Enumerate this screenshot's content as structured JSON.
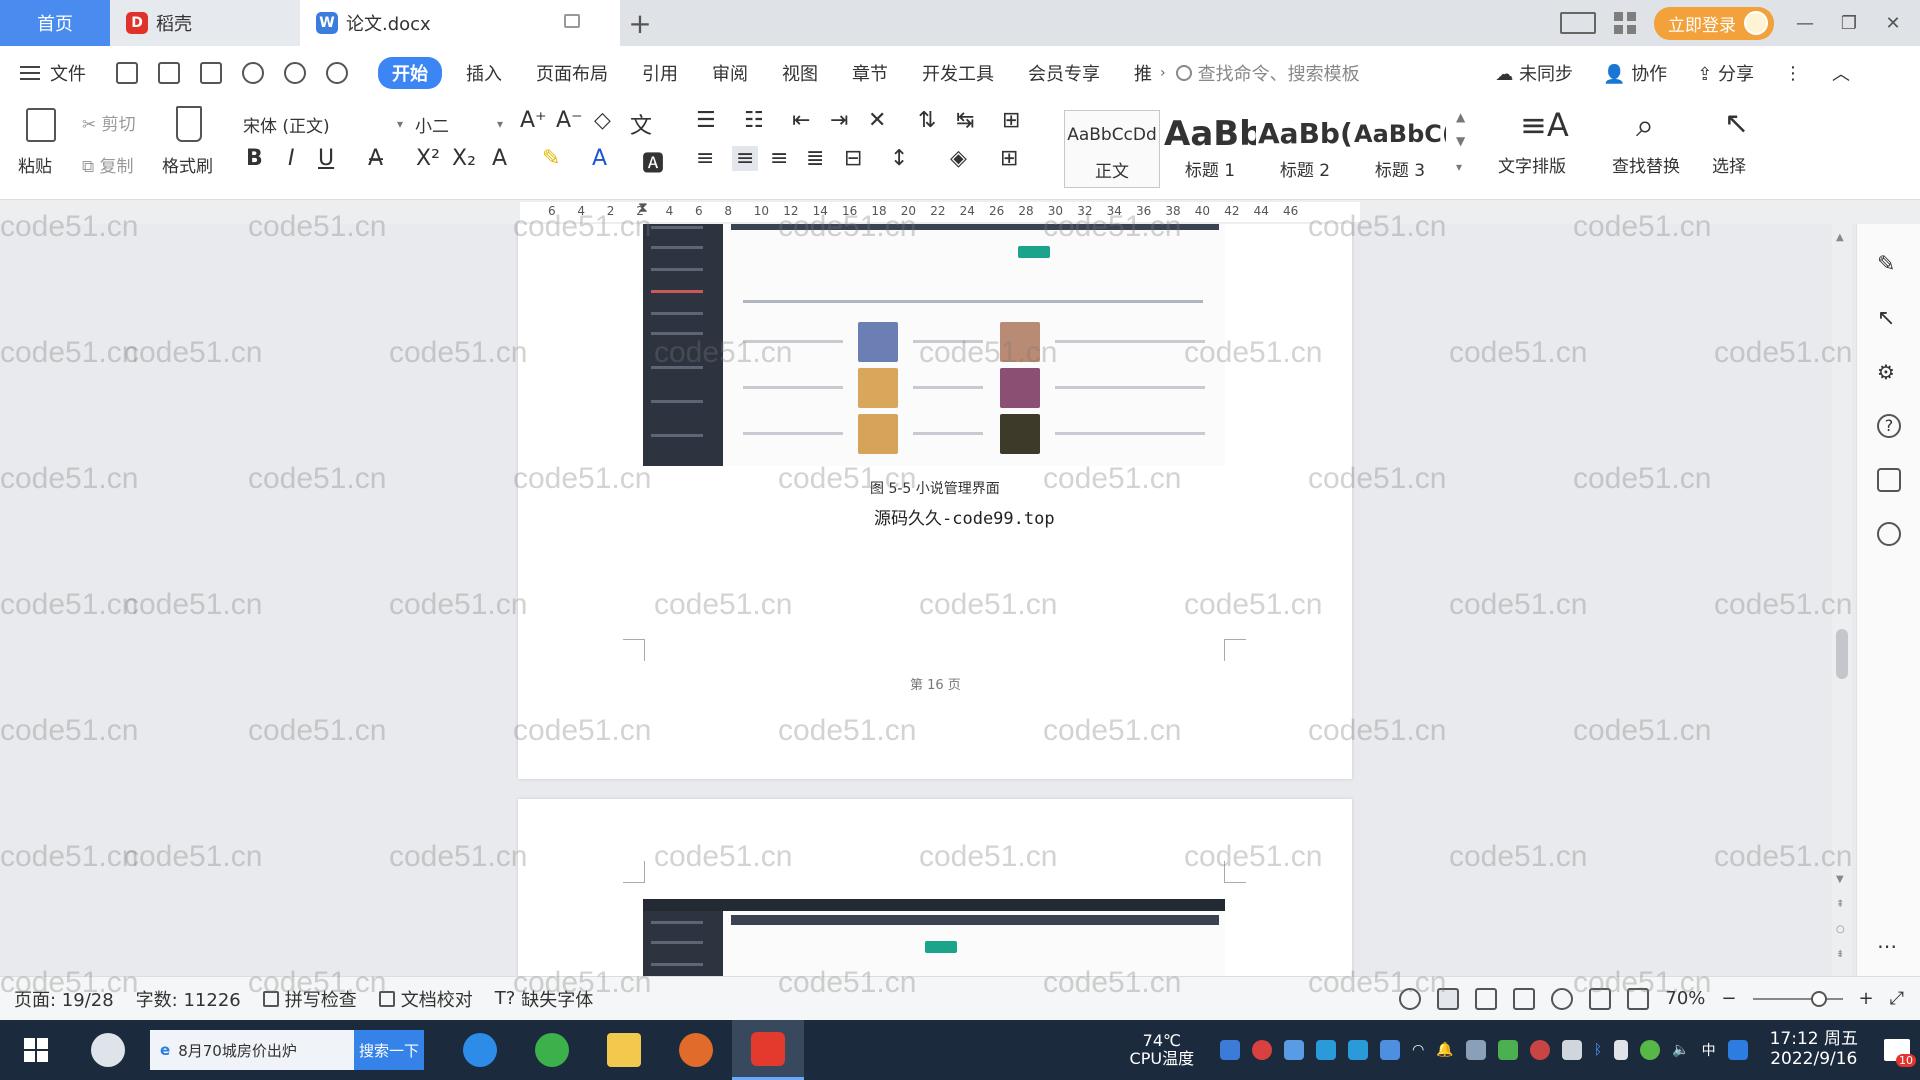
{
  "tabs": {
    "home": "首页",
    "daoke": "稻壳",
    "doc": "论文.docx",
    "new_tab": "+"
  },
  "titlebar": {
    "login": "立即登录"
  },
  "menu": {
    "file": "文件",
    "items": [
      "开始",
      "插入",
      "页面布局",
      "引用",
      "审阅",
      "视图",
      "章节",
      "开发工具",
      "会员专享",
      "推"
    ],
    "active_index": 0,
    "search_cmd": "查找命令、搜索模板",
    "unsynced": "未同步",
    "collab": "协作",
    "share": "分享"
  },
  "ribbon": {
    "paste": "粘贴",
    "cut": "剪切",
    "copy": "复制",
    "format_painter": "格式刷",
    "font_name": "宋体 (正文)",
    "font_size": "小二",
    "styles": [
      {
        "sample": "AaBbCcDd",
        "caption": "正文"
      },
      {
        "sample": "AaBb",
        "caption": "标题 1"
      },
      {
        "sample": "AaBb(",
        "caption": "标题 2"
      },
      {
        "sample": "AaBbC(",
        "caption": "标题 3"
      }
    ],
    "text_layout": "文字排版",
    "find_replace": "查找替换",
    "select": "选择"
  },
  "ruler": {
    "ticks": [
      "6",
      "4",
      "2",
      "2",
      "4",
      "6",
      "8",
      "10",
      "12",
      "14",
      "16",
      "18",
      "20",
      "22",
      "24",
      "26",
      "28",
      "30",
      "32",
      "34",
      "36",
      "38",
      "40",
      "42",
      "44",
      "46"
    ]
  },
  "document": {
    "figure_caption": "图 5-5 小说管理界面",
    "source_line": "源码久久-code99.top",
    "page_label": "第 16 页"
  },
  "status": {
    "page": "页面: 19/28",
    "words": "字数: 11226",
    "spellcheck": "拼写检查",
    "proofread": "文档校对",
    "missing_font": "缺失字体",
    "zoom": "70%"
  },
  "taskbar": {
    "search_text": "8月70城房价出炉",
    "search_button": "搜索一下",
    "temp": "74℃",
    "temp_label": "CPU温度",
    "ime": "中",
    "time": "17:12 周五",
    "date": "2022/9/16",
    "notifications": "10"
  },
  "watermark": "code51.cn",
  "colors": {
    "accent": "#3c85f5",
    "home_tab": "#4a8bf0",
    "login": "#f2a13b",
    "taskbar": "#1b2a3d"
  }
}
